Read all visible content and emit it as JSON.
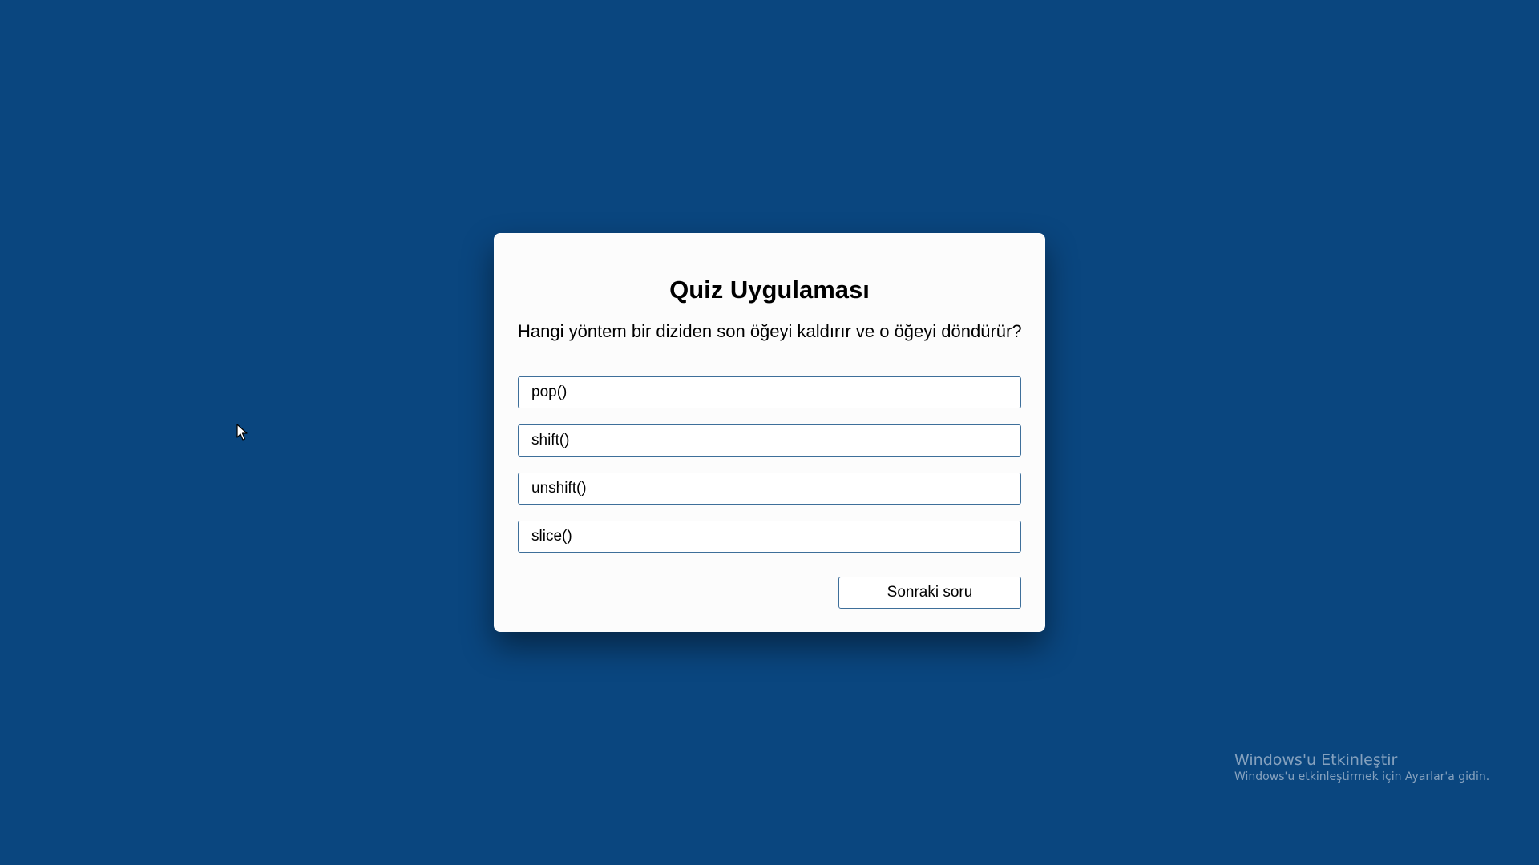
{
  "quiz": {
    "title": "Quiz Uygulaması",
    "question": "Hangi yöntem bir diziden son öğeyi kaldırır ve o öğeyi döndürür?",
    "options": [
      "pop()",
      "shift()",
      "unshift()",
      "slice()"
    ],
    "next_label": "Sonraki soru"
  },
  "watermark": {
    "title": "Windows'u Etkinleştir",
    "subtitle": "Windows'u etkinleştirmek için Ayarlar'a gidin."
  },
  "colors": {
    "background": "#0a467f",
    "card": "#fcfcfc",
    "border": "#3e6f9a"
  },
  "icons": {
    "cursor": "mouse-pointer-icon"
  }
}
